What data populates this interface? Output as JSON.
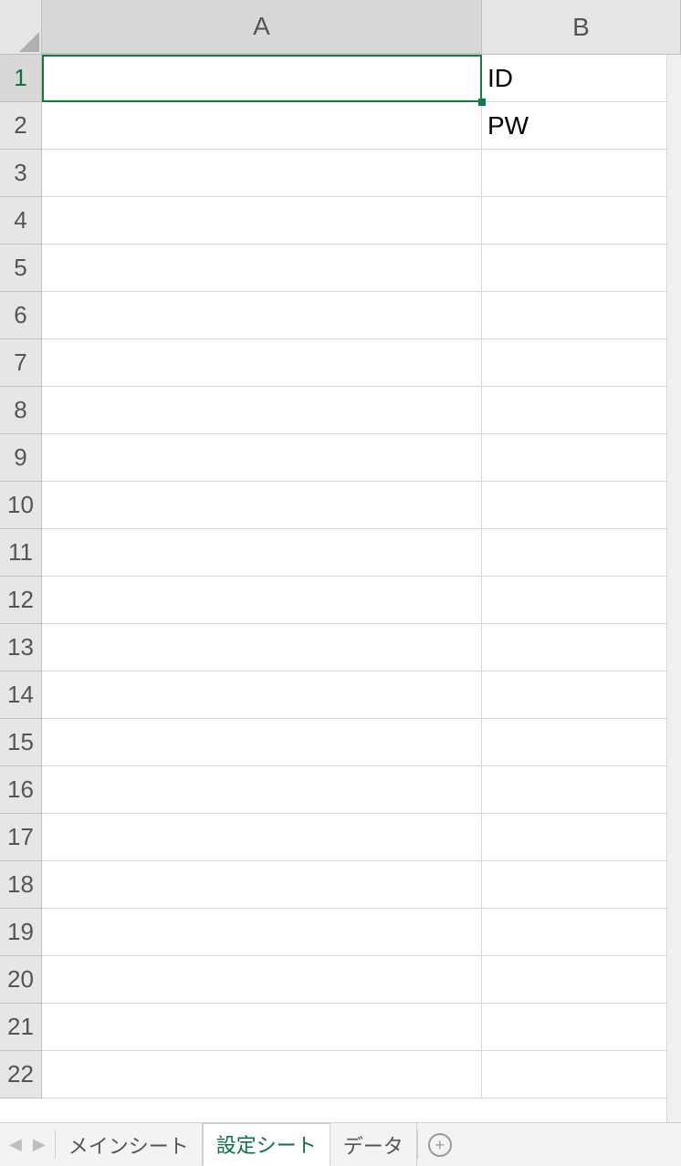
{
  "columns": [
    "A",
    "B"
  ],
  "row_count": 22,
  "active_cell": "A1",
  "cells": {
    "B1": "ID",
    "B2": "PW"
  },
  "tabs": {
    "items": [
      "メインシート",
      "設定シート",
      "データ"
    ],
    "active_index": 1
  },
  "add_tab_glyph": "+"
}
